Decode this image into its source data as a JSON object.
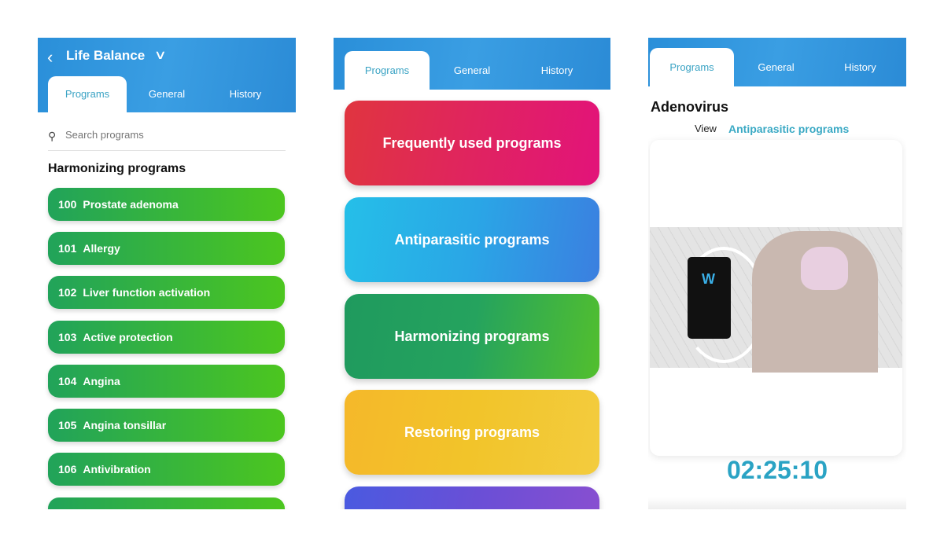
{
  "left": {
    "title": "Life Balance",
    "tabs": [
      "Programs",
      "General",
      "History"
    ],
    "search_placeholder": "Search programs",
    "section": "Harmonizing programs",
    "items": [
      {
        "num": "100",
        "name": "Prostate adenoma"
      },
      {
        "num": "101",
        "name": "Allergy"
      },
      {
        "num": "102",
        "name": "Liver function activation"
      },
      {
        "num": "103",
        "name": "Active protection"
      },
      {
        "num": "104",
        "name": "Angina"
      },
      {
        "num": "105",
        "name": "Angina tonsillar"
      },
      {
        "num": "106",
        "name": "Antivibration"
      },
      {
        "num": "",
        "name": ""
      }
    ]
  },
  "middle": {
    "tabs": [
      "Programs",
      "General",
      "History"
    ],
    "categories": [
      {
        "label": "Frequently used programs",
        "color": "#e0245f"
      },
      {
        "label": "Antiparasitic programs",
        "color": "#2aa6e6"
      },
      {
        "label": "Harmonizing programs",
        "color": "#25a35e"
      },
      {
        "label": "Restoring programs",
        "color": "#f2c42a"
      },
      {
        "label": "",
        "color": "#6a4fd6"
      }
    ]
  },
  "right": {
    "tabs": [
      "Programs",
      "General",
      "History"
    ],
    "title": "Adenovirus",
    "view_label": "View",
    "view_category": "Antiparasitic programs",
    "timer": "02:25:10",
    "accent": "#2aa3c4"
  }
}
